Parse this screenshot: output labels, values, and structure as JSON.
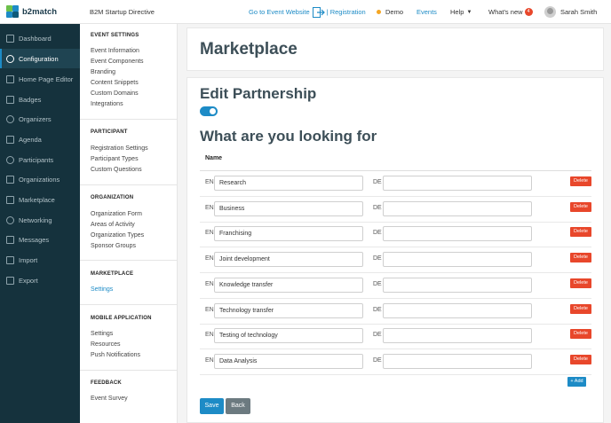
{
  "app": {
    "logo_text": "b2match",
    "event_name": "B2M Startup Directive"
  },
  "topnav": {
    "go_to_event": "Go to Event Website",
    "registration": "| Registration",
    "demo": "Demo",
    "events": "Events",
    "help": "Help",
    "whats_new": "What's new",
    "whats_new_count": "4",
    "user_name": "Sarah Smith"
  },
  "sidebar": {
    "items": [
      {
        "label": "Dashboard",
        "icon": "dashboard-icon"
      },
      {
        "label": "Configuration",
        "icon": "gear-icon",
        "active": true
      },
      {
        "label": "Home Page Editor",
        "icon": "home-icon"
      },
      {
        "label": "Badges",
        "icon": "badge-icon"
      },
      {
        "label": "Organizers",
        "icon": "organizers-icon"
      },
      {
        "label": "Agenda",
        "icon": "agenda-icon"
      },
      {
        "label": "Participants",
        "icon": "participants-icon"
      },
      {
        "label": "Organizations",
        "icon": "organizations-icon"
      },
      {
        "label": "Marketplace",
        "icon": "marketplace-icon"
      },
      {
        "label": "Networking",
        "icon": "networking-icon"
      },
      {
        "label": "Messages",
        "icon": "messages-icon"
      },
      {
        "label": "Import",
        "icon": "import-icon"
      },
      {
        "label": "Export",
        "icon": "export-icon"
      }
    ]
  },
  "submenu": {
    "event_settings": {
      "title": "EVENT SETTINGS",
      "items": [
        "Event Information",
        "Event Components",
        "Branding",
        "Content Snippets",
        "Custom Domains",
        "Integrations"
      ]
    },
    "participant": {
      "title": "PARTICIPANT",
      "items": [
        "Registration Settings",
        "Participant Types",
        "Custom Questions"
      ]
    },
    "organization": {
      "title": "ORGANIZATION",
      "items": [
        "Organization Form",
        "Areas of Activity",
        "Organization Types",
        "Sponsor Groups"
      ]
    },
    "marketplace": {
      "title": "MARKETPLACE",
      "items": [
        "Settings"
      ]
    },
    "mobile": {
      "title": "MOBILE APPLICATION",
      "items": [
        "Settings",
        "Resources",
        "Push Notifications"
      ]
    },
    "feedback": {
      "title": "FEEDBACK",
      "items": [
        "Event Survey"
      ]
    }
  },
  "main": {
    "page_title": "Marketplace",
    "section_title": "Edit Partnership",
    "toggle_on": true,
    "looking_for_title": "What are you looking for",
    "column_name": "Name",
    "lang_en": "EN",
    "lang_de": "DE",
    "delete_label": "Delete",
    "add_label": "+ Add",
    "save_label": "Save",
    "back_label": "Back",
    "rows": [
      {
        "en": "Research",
        "de": ""
      },
      {
        "en": "Business",
        "de": ""
      },
      {
        "en": "Franchising",
        "de": ""
      },
      {
        "en": "Joint development",
        "de": ""
      },
      {
        "en": "Knowledge transfer",
        "de": ""
      },
      {
        "en": "Technology transfer",
        "de": ""
      },
      {
        "en": "Testing of technology",
        "de": ""
      },
      {
        "en": "Data Analysis",
        "de": ""
      }
    ]
  },
  "colors": {
    "accent": "#1d8bc6",
    "sidebar_bg": "#15323d",
    "danger": "#e8472b",
    "demo_dot": "#f5a623"
  }
}
